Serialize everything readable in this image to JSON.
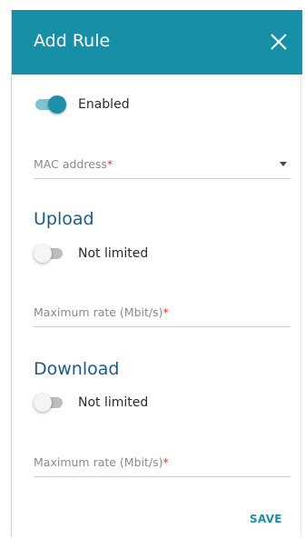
{
  "dialog": {
    "title": "Add Rule",
    "close_icon": "close-icon",
    "accent_color": "#1790a7"
  },
  "enabled": {
    "label": "Enabled",
    "state": true
  },
  "mac_address": {
    "placeholder": "MAC address",
    "required_mark": "*",
    "value": ""
  },
  "upload": {
    "title": "Upload",
    "toggle_label": "Not limited",
    "toggle_state": false,
    "rate_placeholder": "Maximum rate (Mbit/s)",
    "required_mark": "*"
  },
  "download": {
    "title": "Download",
    "toggle_label": "Not limited",
    "toggle_state": false,
    "rate_placeholder": "Maximum rate (Mbit/s)",
    "required_mark": "*"
  },
  "actions": {
    "save_label": "SAVE"
  }
}
